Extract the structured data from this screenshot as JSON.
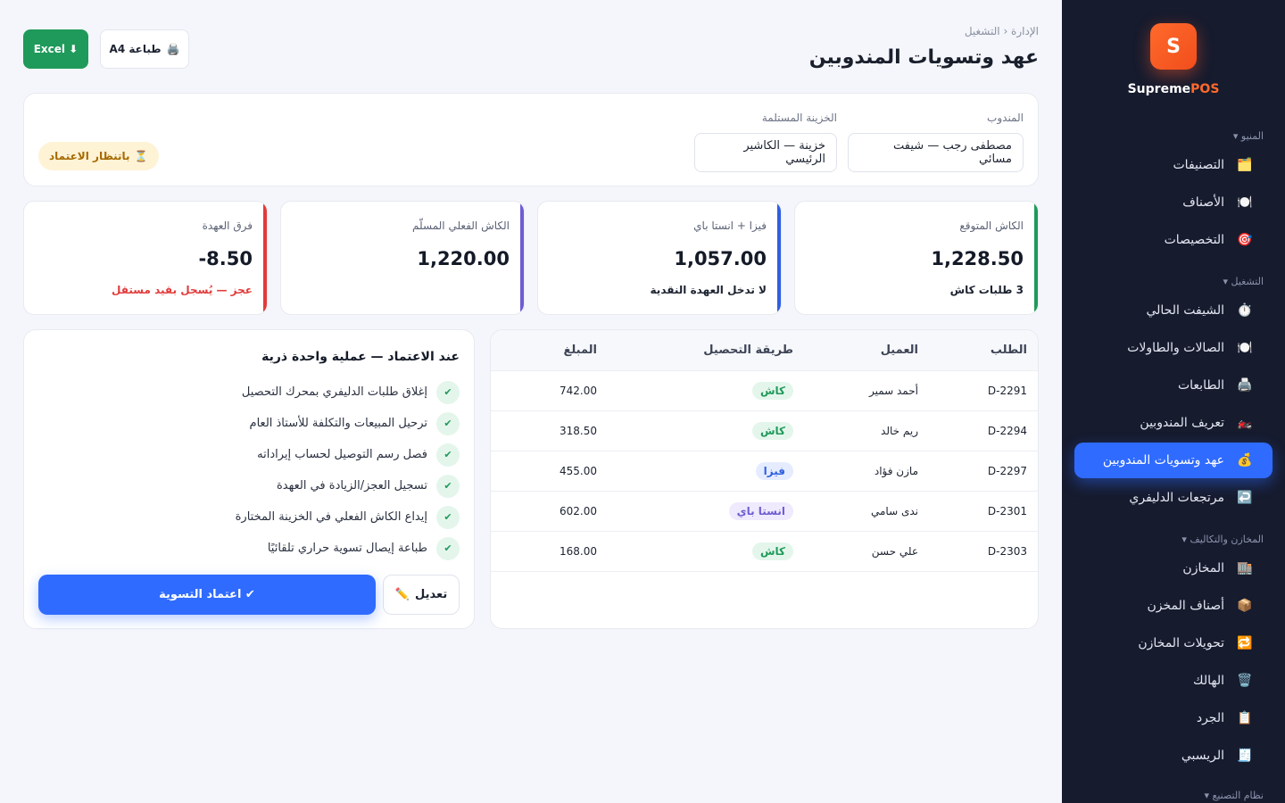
{
  "sidebar": {
    "logo_letter": "S",
    "brand_1": "Supreme",
    "brand_2": "POS",
    "sections": [
      {
        "title": "المنيو ▾"
      },
      {
        "title": "التشغيل ▾"
      },
      {
        "title": "المخازن والتكاليف ▾"
      },
      {
        "title": "نظام التصنيع ▾"
      }
    ],
    "items": [
      {
        "label": "التصنيفات",
        "icon": "🗂️"
      },
      {
        "label": "الأصناف",
        "icon": "🍽️"
      },
      {
        "label": "التخصيصات",
        "icon": "🎯"
      },
      {
        "label": "الشيفت الحالي",
        "icon": "⏱️"
      },
      {
        "label": "الصالات والطاولات",
        "icon": "🍽️"
      },
      {
        "label": "الطابعات",
        "icon": "🖨️"
      },
      {
        "label": "تعريف المندوبين",
        "icon": "🏍️"
      },
      {
        "label": "عهد وتسويات المندوبين",
        "icon": "💰"
      },
      {
        "label": "مرتجعات الدليفري",
        "icon": "↩️"
      },
      {
        "label": "المخازن",
        "icon": "🏬"
      },
      {
        "label": "أصناف المخزن",
        "icon": "📦"
      },
      {
        "label": "تحويلات المخازن",
        "icon": "🔁"
      },
      {
        "label": "الهالك",
        "icon": "🗑️"
      },
      {
        "label": "الجرد",
        "icon": "📋"
      },
      {
        "label": "الريسبي",
        "icon": "🧾"
      }
    ]
  },
  "header": {
    "breadcrumb": "الإدارة ‹ التشغيل",
    "title": "عهد وتسويات المندوبين",
    "excel_label": "Excel ⬇",
    "print_label": "طباعة A4",
    "print_icon": "🖨️"
  },
  "filters": {
    "courier_label": "المندوب",
    "courier_value": "مصطفى رجب — شيفت مسائي",
    "treasury_label": "الخزينة المستلمة",
    "treasury_value": "خزينة — الكاشير الرئيسي",
    "status_badge": "باتنظار الاعتماد",
    "status_icon": "⏳"
  },
  "stats": [
    {
      "label": "الكاش المتوقع",
      "value": "1,228.50",
      "sub": "3 طلبات كاش"
    },
    {
      "label": "فيزا + انستا باي",
      "value": "1,057.00",
      "sub": "لا تدخل العهدة النقدية"
    },
    {
      "label": "الكاش الفعلي المسلّم",
      "value": "1,220.00",
      "sub": ""
    },
    {
      "label": "فرق العهدة",
      "value": "8.50-",
      "sub": "عجز — يُسجل بقيد مستقل"
    }
  ],
  "table": {
    "headers": {
      "order": "الطلب",
      "customer": "العميل",
      "method": "طريقة التحصيل",
      "amount": "المبلغ"
    },
    "rows": [
      {
        "order": "D-2291",
        "customer": "أحمد سمير",
        "method": "كاش",
        "amount": "742.00"
      },
      {
        "order": "D-2294",
        "customer": "ريم خالد",
        "method": "كاش",
        "amount": "318.50"
      },
      {
        "order": "D-2297",
        "customer": "مازن فؤاد",
        "method": "فيزا",
        "amount": "455.00"
      },
      {
        "order": "D-2301",
        "customer": "ندى سامي",
        "method": "انستا باي",
        "amount": "602.00"
      },
      {
        "order": "D-2303",
        "customer": "علي حسن",
        "method": "كاش",
        "amount": "168.00"
      }
    ]
  },
  "approval": {
    "title": "عند الاعتماد — عملية واحدة ذرية",
    "items": [
      "إغلاق طلبات الدليفري بمحرك التحصيل",
      "ترحيل المبيعات والتكلفة للأستاذ العام",
      "فصل رسم التوصيل لحساب إيراداته",
      "تسجيل العجز/الزيادة في العهدة",
      "إيداع الكاش الفعلي في الخزينة المختارة",
      "طباعة إيصال تسوية حراري تلقائيًا"
    ],
    "check_glyph": "✔",
    "approve_label": "✔ اعتماد التسوية",
    "edit_label": "تعديل",
    "edit_icon": "✏️"
  }
}
